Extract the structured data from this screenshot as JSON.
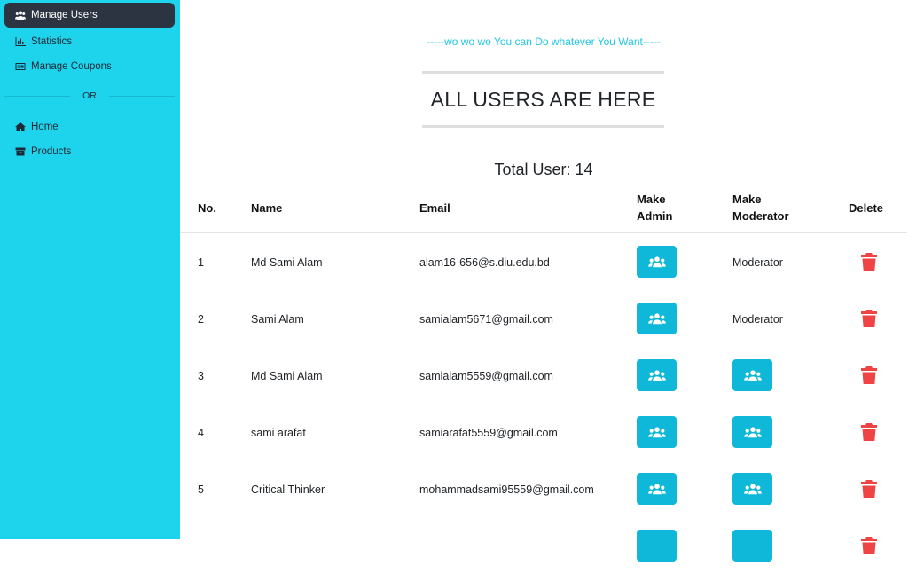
{
  "sidebar": {
    "items": [
      {
        "label": "Manage Users",
        "icon": "users-icon",
        "active": true
      },
      {
        "label": "Statistics",
        "icon": "bar-chart-icon"
      },
      {
        "label": "Manage Coupons",
        "icon": "coupon-icon"
      }
    ],
    "divider_label": "OR",
    "items_secondary": [
      {
        "label": "Home",
        "icon": "home-icon"
      },
      {
        "label": "Products",
        "icon": "box-icon"
      }
    ]
  },
  "main": {
    "tagline": "-----wo wo wo You can Do whatever You Want-----",
    "title": "ALL USERS ARE HERE",
    "total": "Total User: 14",
    "columns": {
      "no": "No.",
      "name": "Name",
      "email": "Email",
      "make_admin_1": "Make",
      "make_admin_2": "Admin",
      "make_moderator_1": "Make",
      "make_moderator_2": "Moderator",
      "delete": "Delete"
    },
    "rows": [
      {
        "no": "1",
        "name": "Md Sami Alam",
        "email": "alam16-656@s.diu.edu.bd",
        "moderator": "Moderator"
      },
      {
        "no": "2",
        "name": "Sami Alam",
        "email": "samialam5671@gmail.com",
        "moderator": "Moderator"
      },
      {
        "no": "3",
        "name": "Md Sami Alam",
        "email": "samialam5559@gmail.com"
      },
      {
        "no": "4",
        "name": "sami arafat",
        "email": "samiarafat5559@gmail.com"
      },
      {
        "no": "5",
        "name": "Critical Thinker",
        "email": "mohammadsami95559@gmail.com"
      }
    ]
  },
  "colors": {
    "sidebar_bg": "#1ed3ec",
    "active_bg": "#2b3440",
    "button_bg": "#0fb8d8",
    "delete_icon": "#ef4444",
    "tagline": "#22c7e2"
  }
}
